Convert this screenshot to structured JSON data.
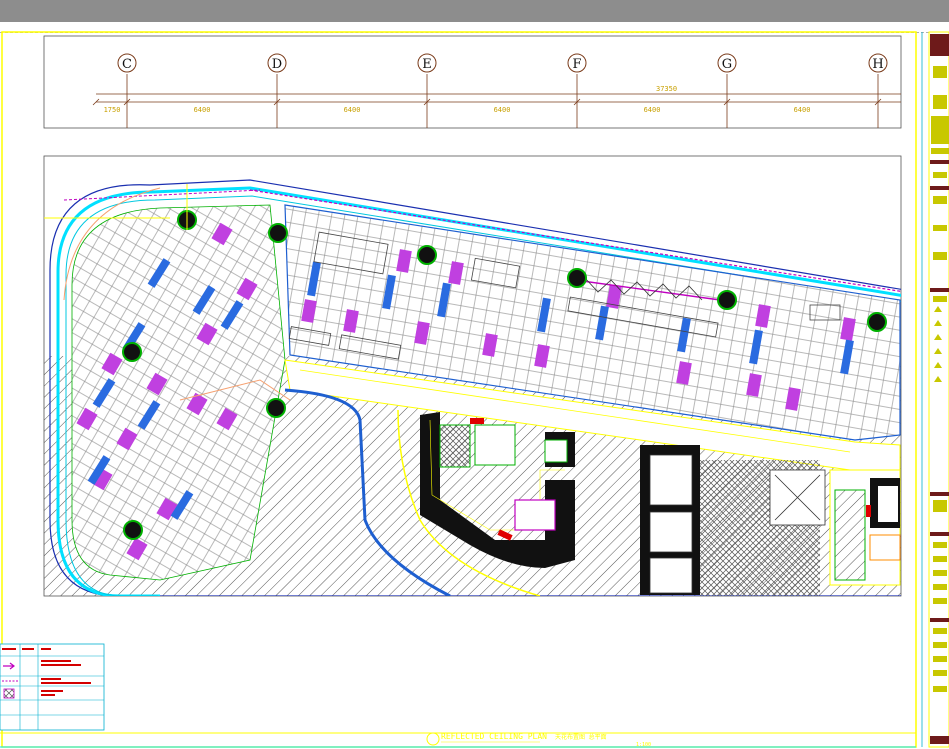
{
  "grid": {
    "axes": [
      {
        "label": "C"
      },
      {
        "label": "D"
      },
      {
        "label": "E"
      },
      {
        "label": "F"
      },
      {
        "label": "G"
      },
      {
        "label": "H"
      }
    ],
    "total_dimension": "37350",
    "dimensions": [
      "1750",
      "6400",
      "6400",
      "6400",
      "6400",
      "6400"
    ]
  },
  "footer": {
    "title": "REFLECTED CEILING PLAN",
    "subtitle": "天花布置图 总平面",
    "scale": "1:100"
  },
  "colors": {
    "frame": "#ffff00",
    "wall_fill": "#000000",
    "grid_line": "#7a3b1a",
    "cyan": "#00e0ff",
    "blue": "#1e5fd0",
    "magenta": "#b12ad8",
    "green": "#00b000",
    "hatch": "#555555"
  },
  "legend": {
    "icons": [
      "arrow-icon",
      "dashed-line-icon",
      "hatch-square-icon"
    ]
  }
}
